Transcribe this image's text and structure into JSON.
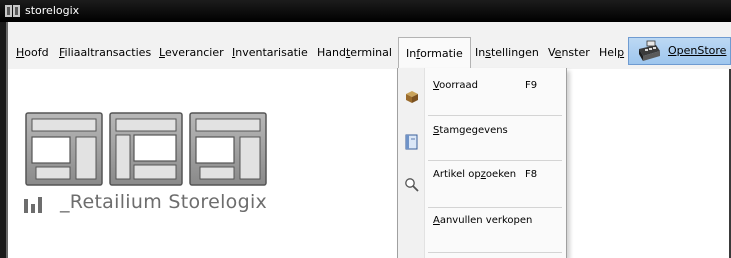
{
  "window": {
    "title": "storelogix"
  },
  "menubar": {
    "items": [
      {
        "label": "Hoofd",
        "key": "H"
      },
      {
        "label": "Filiaaltransacties",
        "key": "F"
      },
      {
        "label": "Leverancier",
        "key": "L"
      },
      {
        "label": "Inventarisatie",
        "key": "I"
      },
      {
        "label": "Handterminal",
        "key": "t"
      },
      {
        "label": "Informatie",
        "key": "f"
      },
      {
        "label": "Instellingen",
        "key": "s"
      },
      {
        "label": "Venster",
        "key": "e"
      },
      {
        "label": "Help",
        "key": "p"
      }
    ],
    "openstore_label": "OpenStore"
  },
  "logo": {
    "tagline": "_Retailium Storelogix"
  },
  "dropdown": {
    "items": [
      {
        "label": "Voorraad",
        "shortcut": "F9",
        "icon": "box-icon"
      },
      {
        "label": "Stamgegevens",
        "shortcut": "",
        "icon": "book-icon"
      },
      {
        "label": "Artikel opzoeken",
        "shortcut": "F8",
        "icon": "magnifier-icon"
      },
      {
        "label": "Aanvullen verkopen",
        "shortcut": "",
        "icon": ""
      }
    ]
  },
  "colors": {
    "titlebar": "#000000",
    "menubar": "#f2f2f2",
    "openstore_bg": "#a8cdf0",
    "logo_gray": "#9a9a9a"
  }
}
